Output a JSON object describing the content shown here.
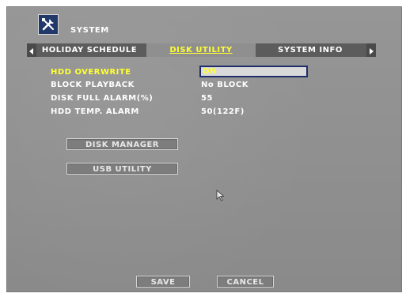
{
  "header": {
    "title": "SYSTEM",
    "icon": "tools-icon"
  },
  "tabs": [
    {
      "label": "HOLIDAY SCHEDULE",
      "active": false
    },
    {
      "label": "DISK UTILITY",
      "active": true
    },
    {
      "label": "SYSTEM INFO",
      "active": false
    }
  ],
  "settings": {
    "hdd_overwrite": {
      "label": "HDD OVERWRITE",
      "value": "ON"
    },
    "block_playback": {
      "label": "BLOCK PLAYBACK",
      "value": "No BLOCK"
    },
    "disk_full_alarm": {
      "label": "DISK FULL ALARM(%)",
      "value": "55"
    },
    "hdd_temp_alarm": {
      "label": "HDD TEMP. ALARM",
      "value": "50(122F)"
    }
  },
  "actions": {
    "disk_manager": "DISK MANAGER",
    "usb_utility": "USB UTILITY"
  },
  "footer": {
    "save": "SAVE",
    "cancel": "CANCEL"
  },
  "colors": {
    "highlight": "#ffff33",
    "tab_bar": "#5c5c5c",
    "selection_border": "#1f2d6b"
  }
}
